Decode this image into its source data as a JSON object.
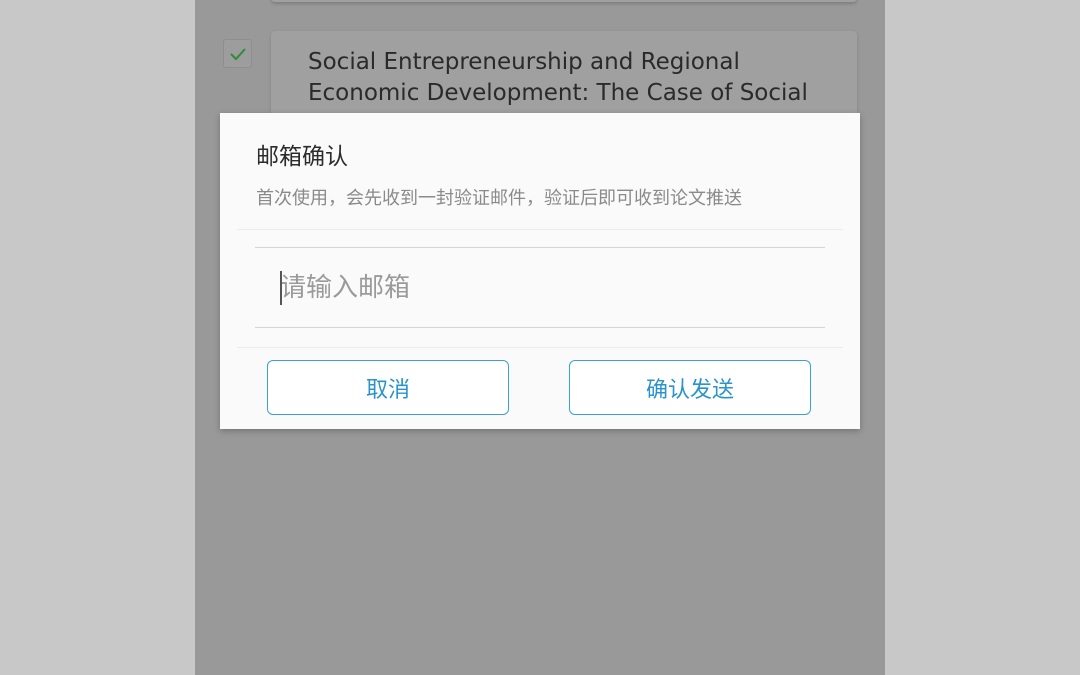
{
  "paper_list": {
    "selected_item": {
      "checked": true,
      "title": "Social Entrepreneurship and Regional Economic Development: The Case of Social"
    }
  },
  "dialog": {
    "title": "邮箱确认",
    "subtitle": "首次使用，会先收到一封验证邮件，验证后即可收到论文推送",
    "email_input": {
      "value": "",
      "placeholder": "请输入邮箱"
    },
    "buttons": {
      "cancel_label": "取消",
      "confirm_label": "确认发送"
    },
    "accent_color": "#3da0d4"
  },
  "colors": {
    "overlay_gray": "#999999",
    "side_gray": "#c8c8c8",
    "check_green": "#2e8b3a"
  },
  "icons": {
    "checkbox": "check-icon"
  }
}
